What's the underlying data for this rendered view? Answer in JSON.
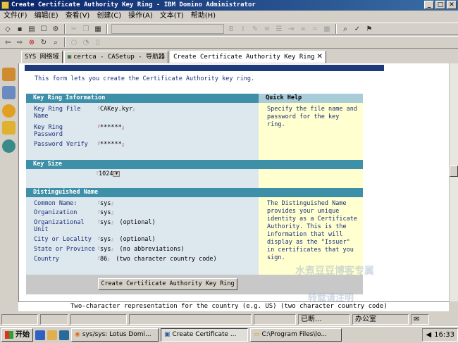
{
  "window": {
    "title": "Create Certificate Authority Key Ring - IBM Domino Administrator",
    "buttons": [
      "_",
      "□",
      "✕"
    ]
  },
  "menu": [
    "文件(F)",
    "编辑(E)",
    "查看(V)",
    "创建(C)",
    "操作(A)",
    "文本(T)",
    "帮助(H)"
  ],
  "tabs": [
    {
      "label": "SYS 网络域"
    },
    {
      "label": "certca - CASetup - 导航器"
    },
    {
      "label": "Create Certificate Authority Key Ring",
      "active": true
    }
  ],
  "intro": "This form lets you create the Certificate Authority key ring.",
  "sections": {
    "key_ring": "Key Ring Information",
    "quick_help": "Quick Help",
    "key_size": "Key Size",
    "dn": "Distinguished Name"
  },
  "fields": {
    "key_ring_file": {
      "label": "Key Ring File Name",
      "value": "CAKey.kyr"
    },
    "key_ring_password": {
      "label": "Key Ring Password",
      "value": "******"
    },
    "password_verify": {
      "label": "Password Verify",
      "value": "******"
    },
    "key_size": {
      "value": "1024"
    },
    "common_name": {
      "label": "Common Name:",
      "value": "sys"
    },
    "organization": {
      "label": "Organization",
      "value": "sys"
    },
    "org_unit": {
      "label": "Organizational Unit",
      "value": "sys",
      "note": "(optional)"
    },
    "city": {
      "label": "City or Locality",
      "value": "sys",
      "note": "(optional)"
    },
    "state": {
      "label": "State or Province",
      "value": "sys",
      "note": "(no abbreviations)"
    },
    "country": {
      "label": "Country",
      "value": "86",
      "note": "(two character country code)"
    }
  },
  "help": {
    "key_ring": "Specify the file name and password for the key ring.",
    "dn": "The Distinguished Name provides your unique identity as a Certificate Authority.  This is the information that will display as the \"Issuer\" in certificates that you sign."
  },
  "create_button": "Create Certificate Authority Key Ring",
  "hint": "Two-character representation for the country (e.g. US) (two character country code)",
  "status": {
    "box1": "已断...",
    "box2": "办公室"
  },
  "taskbar": {
    "start": "开始",
    "buttons": [
      {
        "label": "sys/sys: Lotus Domi..."
      },
      {
        "label": "Create Certificate ...",
        "active": true
      },
      {
        "label": "C:\\Program Files\\lo..."
      }
    ],
    "clock": "16:33"
  },
  "watermark": {
    "line1": "水煮豆豆博客专属",
    "line2": "转载请注明"
  }
}
